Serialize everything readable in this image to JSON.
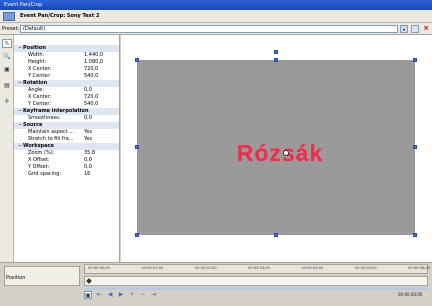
{
  "window": {
    "title": "Event Pan/Crop"
  },
  "header": {
    "title": "Event Pan/Crop: Sony Text 2"
  },
  "preset": {
    "label": "Preset:",
    "value": "(Default)",
    "dropdown_glyph": "▾"
  },
  "toolstrip": {
    "tools": [
      {
        "name": "normal-edit-tool-icon",
        "glyph": "⇖",
        "active": true
      },
      {
        "name": "zoom-tool-icon",
        "glyph": "🔍",
        "active": false
      },
      {
        "name": "lock-aspect-icon",
        "glyph": "▣",
        "active": false
      },
      {
        "name": "size-about-center-icon",
        "glyph": "▤",
        "active": false
      },
      {
        "name": "move-freely-icon",
        "glyph": "✛",
        "active": false
      }
    ]
  },
  "properties": {
    "sections": [
      {
        "title": "Position",
        "rows": [
          {
            "key": "Width:",
            "value": "1.440,0"
          },
          {
            "key": "Height:",
            "value": "1.080,0"
          },
          {
            "key": "X Center:",
            "value": "720,0"
          },
          {
            "key": "Y Center:",
            "value": "540,0"
          }
        ]
      },
      {
        "title": "Rotation",
        "rows": [
          {
            "key": "Angle:",
            "value": "0,0"
          },
          {
            "key": "X Center:",
            "value": "720,0"
          },
          {
            "key": "Y Center:",
            "value": "540,0"
          }
        ]
      },
      {
        "title": "Keyframe interpolation",
        "rows": [
          {
            "key": "Smoothness:",
            "value": "0,0"
          }
        ]
      },
      {
        "title": "Source",
        "rows": [
          {
            "key": "Maintain aspect ...",
            "value": "Yes"
          },
          {
            "key": "Stretch to fill fra...",
            "value": "Yes"
          }
        ]
      },
      {
        "title": "Workspace",
        "rows": [
          {
            "key": "Zoom (%):",
            "value": "35,8"
          },
          {
            "key": "X Offset:",
            "value": "0,0"
          },
          {
            "key": "Y Offset:",
            "value": "0,0"
          },
          {
            "key": "Grid spacing:",
            "value": "16"
          }
        ]
      }
    ]
  },
  "canvas": {
    "overlay_text": "Rózsák"
  },
  "timeline": {
    "track_label": "Position",
    "ruler_ticks": [
      "00:00:00;00",
      "00:00:01;00",
      "00:00:02;00",
      "00:00:03;00",
      "00:00:04;00",
      "00:00:05;00",
      "00:00:06;00"
    ],
    "timecode": "00:00:00;00",
    "transport": [
      {
        "name": "sync-cursor-icon",
        "glyph": "▣",
        "active": true
      },
      {
        "name": "first-keyframe-icon",
        "glyph": "⇤",
        "active": false
      },
      {
        "name": "prev-keyframe-icon",
        "glyph": "◀",
        "active": false
      },
      {
        "name": "next-keyframe-icon",
        "glyph": "▶",
        "active": false
      },
      {
        "name": "add-keyframe-icon",
        "glyph": "+",
        "active": false
      },
      {
        "name": "delete-keyframe-icon",
        "glyph": "−",
        "active": false
      },
      {
        "name": "last-keyframe-icon",
        "glyph": "⇥",
        "active": false
      }
    ]
  },
  "colors": {
    "accent": "#2b63d6",
    "overlay_text": "#e2324e",
    "frame": "#9a9a9a",
    "handle": "#4a6acd"
  }
}
